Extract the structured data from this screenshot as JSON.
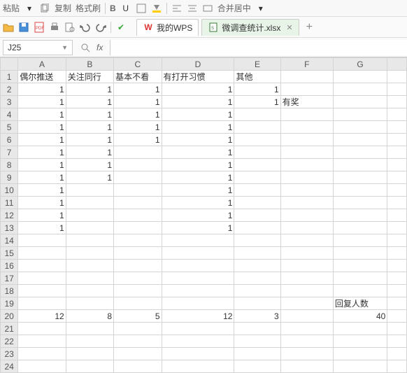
{
  "topbar": {
    "paste_label": "粘贴",
    "copy_label": "复制",
    "format_painter_label": "格式刷",
    "bold_label": "B",
    "merge_label": "合并居中"
  },
  "qat": {
    "wps_tab_label": "我的WPS",
    "file_tab_label": "微调查统计.xlsx"
  },
  "namebox": {
    "ref": "J25"
  },
  "columns": [
    "A",
    "B",
    "C",
    "D",
    "E",
    "F",
    "G"
  ],
  "headers": {
    "A": "偶尔推送",
    "B": "关注同行",
    "C": "基本不看",
    "D": "有打开习惯",
    "E": "其他",
    "F": "",
    "G": ""
  },
  "rows": [
    {
      "r": 1,
      "A": "偶尔推送",
      "B": "关注同行",
      "C": "基本不看",
      "D": "有打开习惯",
      "E": "其他",
      "F": "",
      "G": "",
      "alignA": "left",
      "alignB": "left",
      "alignC": "left",
      "alignD": "left",
      "alignE": "left"
    },
    {
      "r": 2,
      "A": "1",
      "B": "1",
      "C": "1",
      "D": "1",
      "E": "1",
      "F": "",
      "G": ""
    },
    {
      "r": 3,
      "A": "1",
      "B": "1",
      "C": "1",
      "D": "1",
      "E": "1",
      "F": "有奖",
      "G": "",
      "alignF": "left"
    },
    {
      "r": 4,
      "A": "1",
      "B": "1",
      "C": "1",
      "D": "1",
      "E": "",
      "F": "",
      "G": ""
    },
    {
      "r": 5,
      "A": "1",
      "B": "1",
      "C": "1",
      "D": "1",
      "E": "",
      "F": "",
      "G": ""
    },
    {
      "r": 6,
      "A": "1",
      "B": "1",
      "C": "1",
      "D": "1",
      "E": "",
      "F": "",
      "G": ""
    },
    {
      "r": 7,
      "A": "1",
      "B": "1",
      "C": "",
      "D": "1",
      "E": "",
      "F": "",
      "G": ""
    },
    {
      "r": 8,
      "A": "1",
      "B": "1",
      "C": "",
      "D": "1",
      "E": "",
      "F": "",
      "G": ""
    },
    {
      "r": 9,
      "A": "1",
      "B": "1",
      "C": "",
      "D": "1",
      "E": "",
      "F": "",
      "G": ""
    },
    {
      "r": 10,
      "A": "1",
      "B": "",
      "C": "",
      "D": "1",
      "E": "",
      "F": "",
      "G": ""
    },
    {
      "r": 11,
      "A": "1",
      "B": "",
      "C": "",
      "D": "1",
      "E": "",
      "F": "",
      "G": ""
    },
    {
      "r": 12,
      "A": "1",
      "B": "",
      "C": "",
      "D": "1",
      "E": "",
      "F": "",
      "G": ""
    },
    {
      "r": 13,
      "A": "1",
      "B": "",
      "C": "",
      "D": "1",
      "E": "",
      "F": "",
      "G": ""
    },
    {
      "r": 14,
      "A": "",
      "B": "",
      "C": "",
      "D": "",
      "E": "",
      "F": "",
      "G": ""
    },
    {
      "r": 15,
      "A": "",
      "B": "",
      "C": "",
      "D": "",
      "E": "",
      "F": "",
      "G": ""
    },
    {
      "r": 16,
      "A": "",
      "B": "",
      "C": "",
      "D": "",
      "E": "",
      "F": "",
      "G": ""
    },
    {
      "r": 17,
      "A": "",
      "B": "",
      "C": "",
      "D": "",
      "E": "",
      "F": "",
      "G": ""
    },
    {
      "r": 18,
      "A": "",
      "B": "",
      "C": "",
      "D": "",
      "E": "",
      "F": "",
      "G": ""
    },
    {
      "r": 19,
      "A": "",
      "B": "",
      "C": "",
      "D": "",
      "E": "",
      "F": "",
      "G": "回复人数",
      "alignG": "left"
    },
    {
      "r": 20,
      "A": "12",
      "B": "8",
      "C": "5",
      "D": "12",
      "E": "3",
      "F": "",
      "G": "40"
    },
    {
      "r": 21,
      "A": "",
      "B": "",
      "C": "",
      "D": "",
      "E": "",
      "F": "",
      "G": ""
    },
    {
      "r": 22,
      "A": "",
      "B": "",
      "C": "",
      "D": "",
      "E": "",
      "F": "",
      "G": ""
    },
    {
      "r": 23,
      "A": "",
      "B": "",
      "C": "",
      "D": "",
      "E": "",
      "F": "",
      "G": ""
    },
    {
      "r": 24,
      "A": "",
      "B": "",
      "C": "",
      "D": "",
      "E": "",
      "F": "",
      "G": ""
    }
  ]
}
